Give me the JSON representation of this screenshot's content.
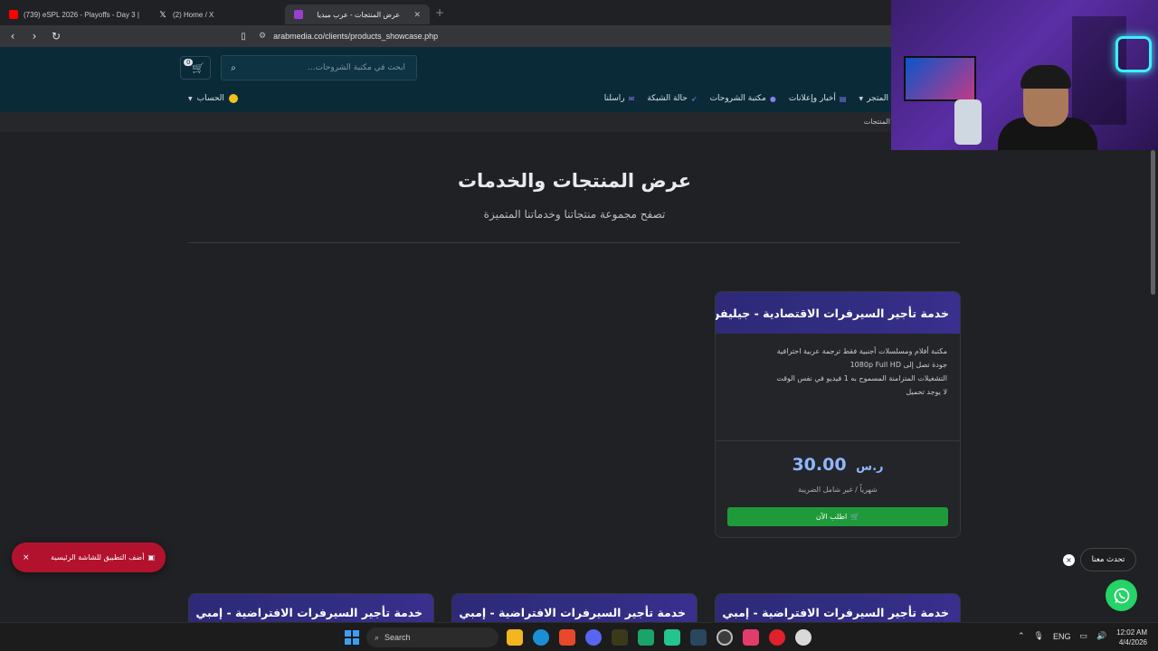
{
  "browser": {
    "tabs": [
      {
        "title": "(739) eSPL 2026 - Playoffs - Day 3 |",
        "favicon_color": "#ff0000"
      },
      {
        "title": "(2) Home / X",
        "favicon_color": "#ffffff"
      },
      {
        "title": "عرض المنتجات - عرب ميديا",
        "favicon_color": "#9b3fd1"
      }
    ],
    "url": "arabmedia.co/clients/products_showcase.php"
  },
  "header": {
    "cart_count": "0",
    "search_placeholder": "ابحث في مكتبة الشروحات...",
    "account_label": "الحساب",
    "nav": [
      "المتجر",
      "أخبار وإعلانات",
      "مكتبة الشروحات",
      "حالة الشبكة",
      "راسلنا"
    ]
  },
  "breadcrumb": "المنتجات",
  "main": {
    "title": "عرض المنتجات والخدمات",
    "subtitle": "تصفح مجموعة منتجاتنا وخدماتنا المتميزة"
  },
  "featured_card": {
    "title": "خدمة تأجير السيرفرات الاقتصادية - جيليفن",
    "features": [
      "مكتبة أفلام ومسلسلات أجنبية فقط ترجمة عربية احترافية",
      "جودة تصل إلى 1080p Full HD",
      "التشغيلات المتزامنة المسموح به 1 فيديو في نفس الوقت",
      "لا يوجد تحميل"
    ],
    "price": "30.00",
    "currency": "ر.س",
    "price_note": "شهرياً / غير شامل الضريبة",
    "order_label": "اطلب الآن",
    "accent_color": "#312d82",
    "button_color": "#1f9a3a"
  },
  "more_cards": [
    {
      "title": "خدمة تأجير السيرفرات الافتراضية - إمبي"
    },
    {
      "title": "خدمة تأجير السيرفرات الافتراضية - إمبي"
    },
    {
      "title": "خدمة تأجير السيرفرات الافتراضية - إمبي"
    }
  ],
  "overlays": {
    "pwa_prompt": "أضف التطبيق للشاشة الرئيسية",
    "chat_label": "تحدث معنا"
  },
  "taskbar": {
    "search_label": "Search",
    "language": "ENG",
    "time": "12:02 AM",
    "date": "4/4/2026"
  }
}
